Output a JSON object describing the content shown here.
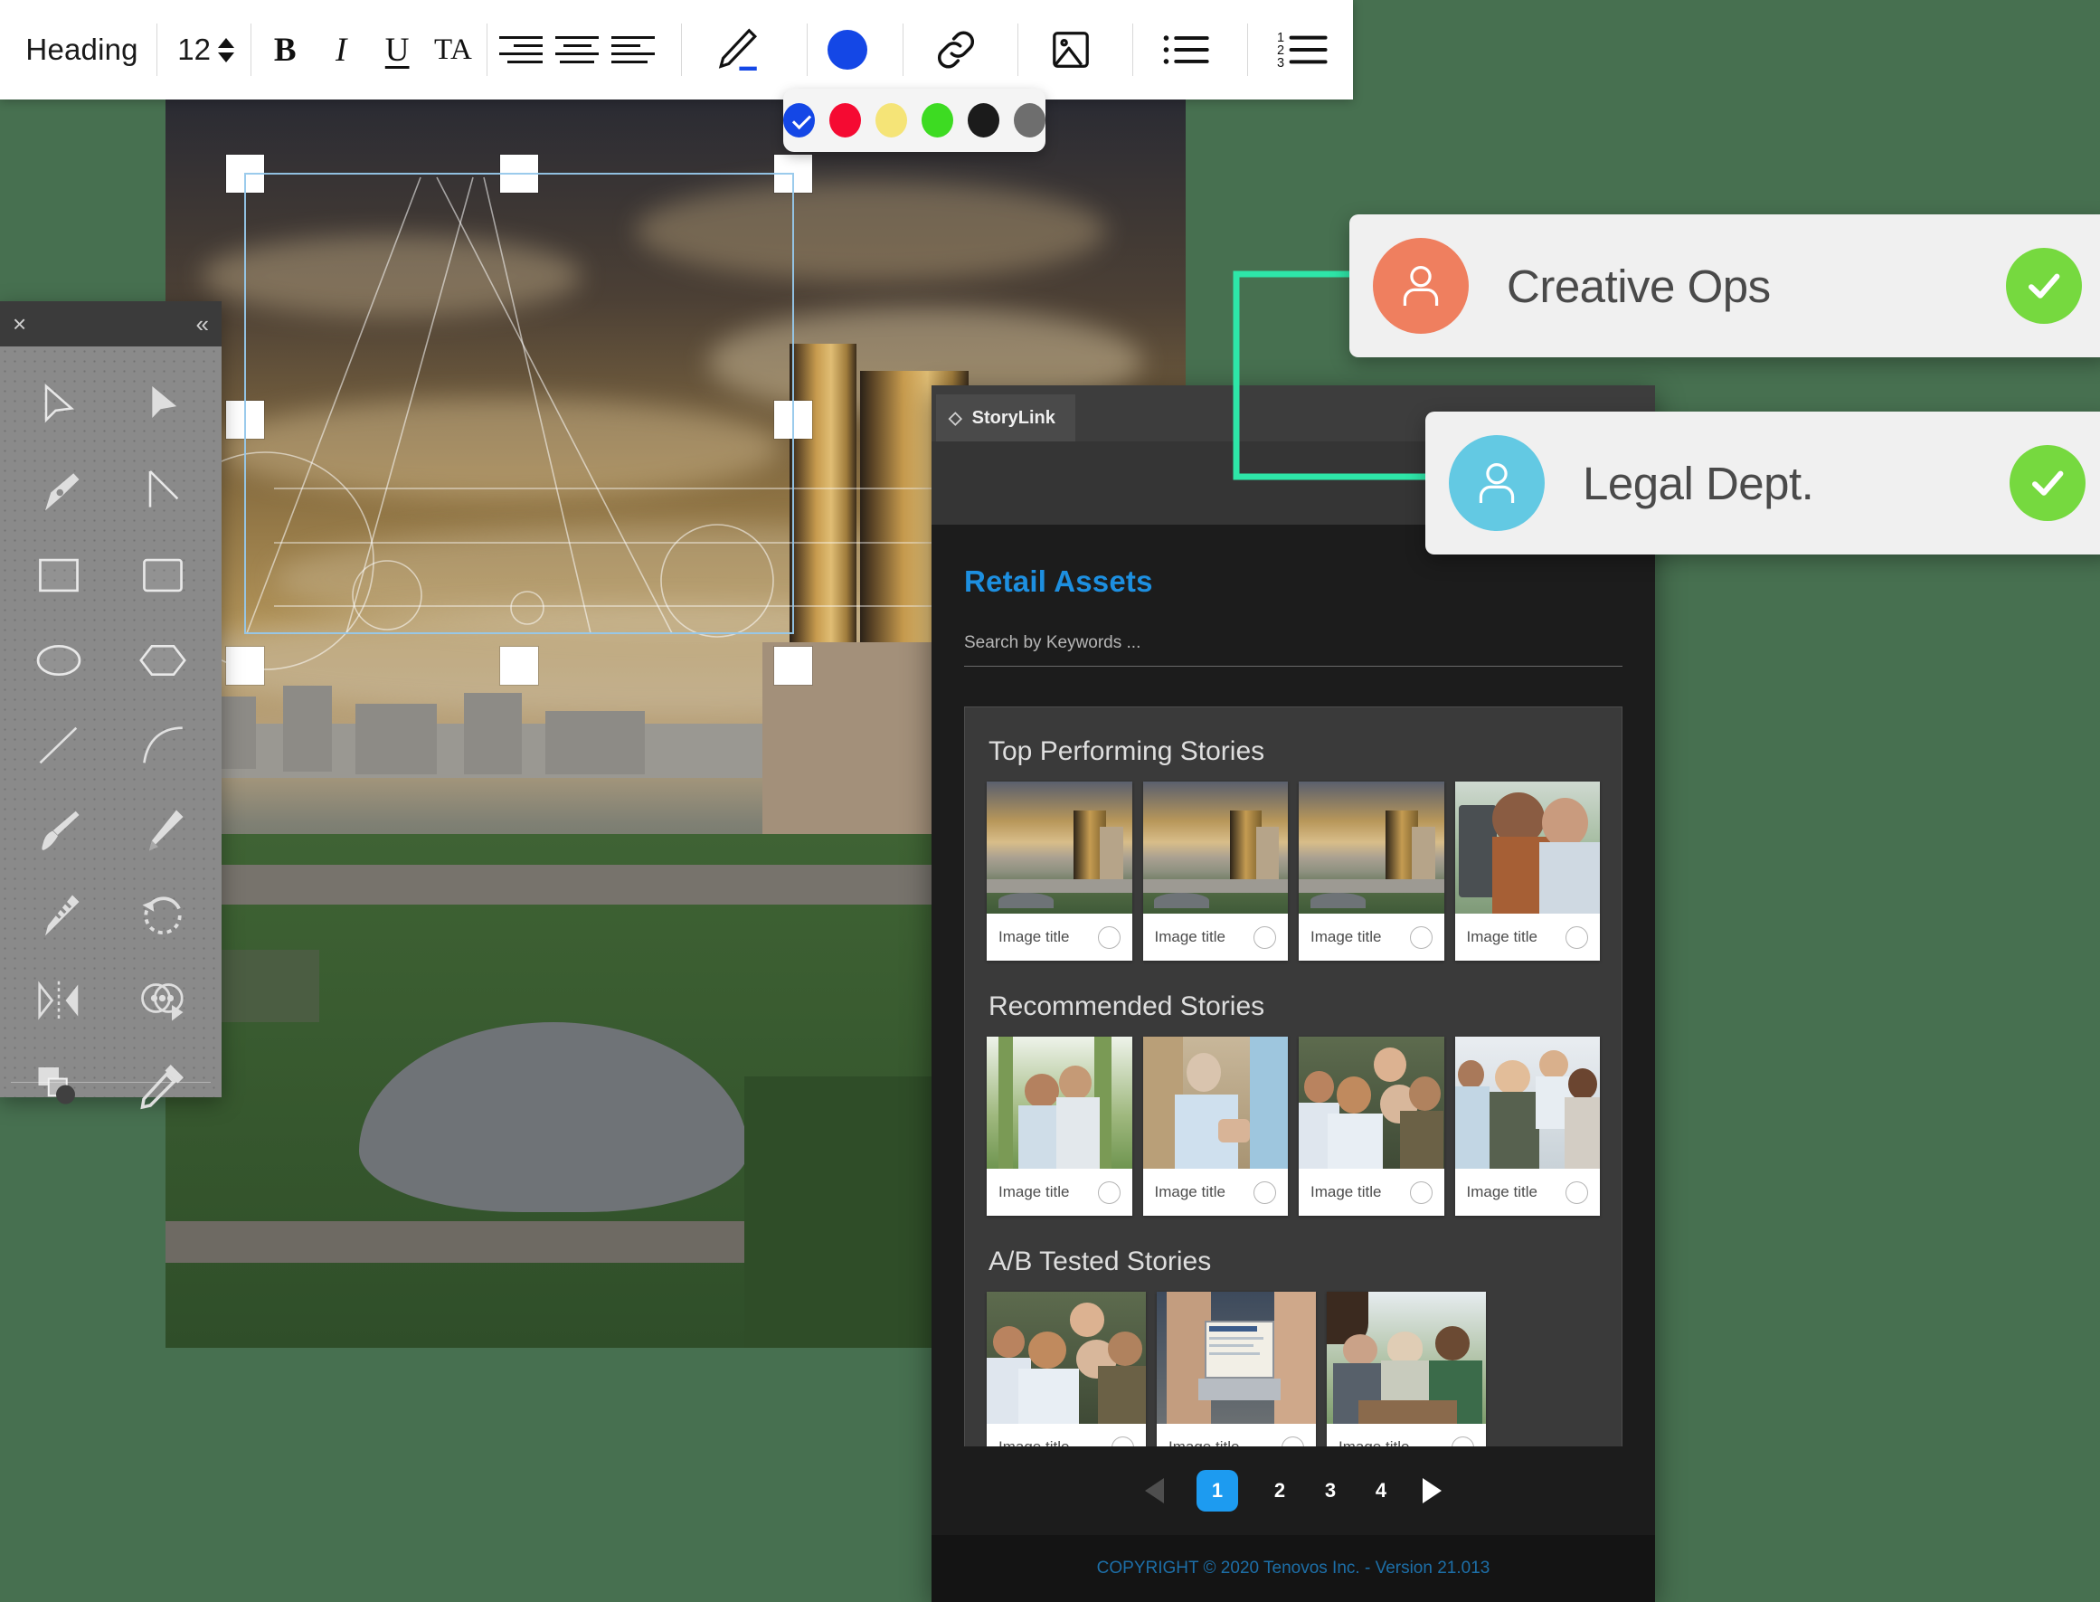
{
  "toolbar": {
    "heading_style": "Heading",
    "font_size": "12",
    "bold_label": "B",
    "italic_label": "I",
    "underline_label": "U",
    "text_all_label": "TA",
    "icons": {
      "stepper_up": "caret-up-icon",
      "stepper_down": "caret-down-icon",
      "align_right": "align-right-icon",
      "align_center": "align-center-icon",
      "align_left": "align-left-icon",
      "pen": "pen-underline-icon",
      "color": "color-swatch-icon",
      "link": "link-icon",
      "image": "image-icon",
      "bullet_list": "bulleted-list-icon",
      "number_list": "numbered-list-icon"
    },
    "current_color": "#1447e6"
  },
  "color_palette": {
    "selected_index": 0,
    "swatches": [
      {
        "name": "blue",
        "hex": "#1447e6"
      },
      {
        "name": "red",
        "hex": "#f50a32"
      },
      {
        "name": "yellow",
        "hex": "#f5e477"
      },
      {
        "name": "green",
        "hex": "#3ddb22"
      },
      {
        "name": "black",
        "hex": "#1b1b1b"
      },
      {
        "name": "gray",
        "hex": "#6e6e6e"
      }
    ]
  },
  "tools_panel": {
    "close_label": "×",
    "collapse_label": "«",
    "tools": [
      {
        "name": "cursor-outline-tool"
      },
      {
        "name": "cursor-filled-tool"
      },
      {
        "name": "pen-nib-tool"
      },
      {
        "name": "path-angle-tool"
      },
      {
        "name": "rectangle-tool"
      },
      {
        "name": "rounded-rectangle-tool"
      },
      {
        "name": "ellipse-tool"
      },
      {
        "name": "polygon-tool"
      },
      {
        "name": "line-tool"
      },
      {
        "name": "arc-tool"
      },
      {
        "name": "paintbrush-tool"
      },
      {
        "name": "pencil-tool"
      },
      {
        "name": "blend-pencil-tool"
      },
      {
        "name": "rotate-tool"
      },
      {
        "name": "mirror-tool"
      },
      {
        "name": "shape-builder-tool"
      },
      {
        "name": "layers-tool"
      },
      {
        "name": "eyedropper-tool"
      }
    ]
  },
  "canvas": {
    "selection_handles": 8,
    "guide_overlay": "letter-a-construction-guides"
  },
  "storylink": {
    "tab_label": "StoryLink",
    "page_title": "Retail Assets",
    "search_placeholder": "Search by Keywords ...",
    "sections": [
      {
        "title": "Top Performing Stories",
        "tiles": [
          {
            "caption": "Image title",
            "thumb": "city-tower-sunset"
          },
          {
            "caption": "Image title",
            "thumb": "city-tower-sunset"
          },
          {
            "caption": "Image title",
            "thumb": "city-tower-sunset"
          },
          {
            "caption": "Image title",
            "thumb": "couple-selfie"
          }
        ]
      },
      {
        "title": "Recommended Stories",
        "tiles": [
          {
            "caption": "Image title",
            "thumb": "couple-outdoors"
          },
          {
            "caption": "Image title",
            "thumb": "handshake-meeting"
          },
          {
            "caption": "Image title",
            "thumb": "group-smiling"
          },
          {
            "caption": "Image title",
            "thumb": "team-standing"
          }
        ]
      },
      {
        "title": "A/B Tested Stories",
        "tiles": [
          {
            "caption": "Image title",
            "thumb": "group-smiling"
          },
          {
            "caption": "Image title",
            "thumb": "laptop-insurance-plans"
          },
          {
            "caption": "Image title",
            "thumb": "seniors-outdoors"
          }
        ]
      }
    ],
    "pagination": {
      "prev_label": "◀",
      "next_label": "▶",
      "pages": [
        "1",
        "2",
        "3",
        "4"
      ],
      "active_page": "1",
      "active_color": "#1d9bf0"
    },
    "footer": {
      "copyright": "COPYRIGHT © 2020 Tenovos Inc. - Version 21.013",
      "color": "#1d6fa8"
    },
    "title_color": "#1d8fe0"
  },
  "approvals": [
    {
      "label": "Creative Ops",
      "avatar_color": "#ef7f5f",
      "status": "approved",
      "status_color": "#76d93f"
    },
    {
      "label": "Legal Dept.",
      "avatar_color": "#63c9e3",
      "status": "approved",
      "status_color": "#76d93f"
    }
  ],
  "connector": {
    "name": "workflow-connector",
    "color": "#2ee6a8"
  },
  "page": {
    "background_color": "#477050"
  }
}
